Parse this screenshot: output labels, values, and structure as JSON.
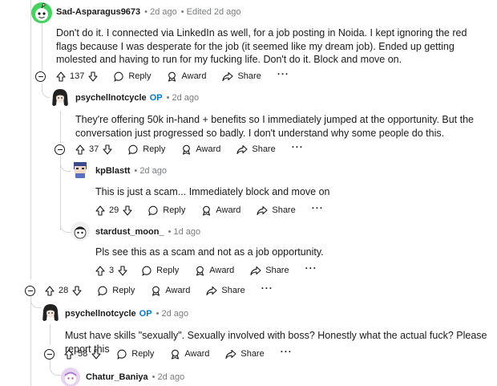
{
  "comments": [
    {
      "author": "Sad-Asparagus9673",
      "time": "• 2d ago",
      "edited": "• Edited 2d ago",
      "body": "Don't do it. I connected via LinkedIn as well, for a job posting in Noida. I kept ignoring the red flags because I was desperate for the job (it seemed like my dream job). Ended up getting molested and having to run for my fucking life. Don't do it. Block and move on.",
      "votes": "137"
    },
    {
      "author": "psychellnotcycle",
      "op": "OP",
      "time": "• 2d ago",
      "body": "They're offering 50k in-hand + benefits so I immediately jumped at the opportunity. But the conversation just progressed so badly. I don't understand why some people do this.",
      "votes": "37"
    },
    {
      "author": "kpBlastt",
      "time": "• 2d ago",
      "body": "This is just a scam... Immediately block and move on",
      "votes": "29"
    },
    {
      "author": "stardust_moon_",
      "time": "• 1d ago",
      "body": "Pls see this as a scam and not as a job opportunity.",
      "votes": "3"
    },
    {
      "votes": "28"
    },
    {
      "author": "psychellnotcycle",
      "op": "OP",
      "time": "• 2d ago",
      "body": "Must have skills \"sexually\". Sexually involved with boss? Honestly what the actual fuck? Please report this",
      "votes": "58"
    },
    {
      "author": "Chatur_Baniya",
      "time": "• 2d ago"
    }
  ],
  "labels": {
    "reply": "Reply",
    "award": "Award",
    "share": "Share",
    "more": "···"
  },
  "icons": [
    "collapse-icon",
    "upvote-icon",
    "downvote-icon",
    "reply-icon",
    "award-icon",
    "share-icon",
    "more-icon"
  ],
  "colors": {
    "op_blue": "#0079d3",
    "meta_gray": "#787c7e",
    "thread_line": "#d4d7d9",
    "avatar_green": "#46d160"
  }
}
